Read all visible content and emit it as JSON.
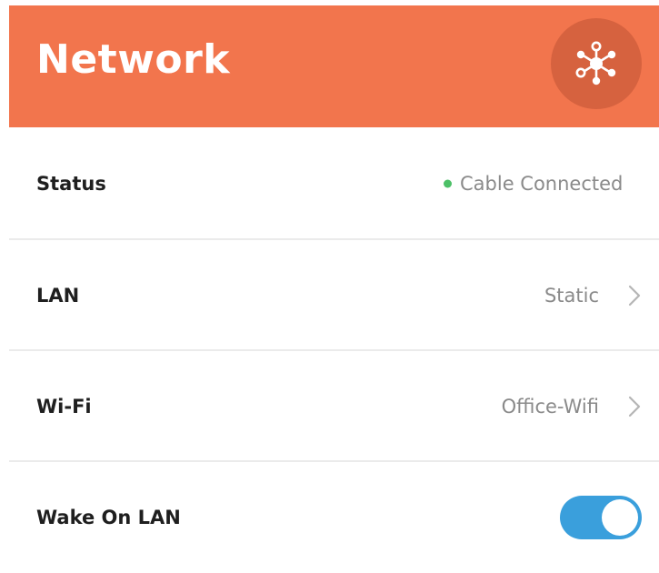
{
  "header": {
    "title": "Network",
    "icon": "network-hub-icon",
    "background_color": "#f2754d",
    "icon_circle_color": "#d6623f"
  },
  "rows": [
    {
      "label": "Status",
      "value": "Cable Connected",
      "status_color": "#4cc067"
    },
    {
      "label": "LAN",
      "value": "Static",
      "chevron": "chevron-right-icon"
    },
    {
      "label": "Wi-Fi",
      "value": "Office-Wifi",
      "chevron": "chevron-right-icon"
    },
    {
      "label": "Wake On LAN",
      "toggle_on": true,
      "toggle_color": "#3a9fdc"
    }
  ]
}
